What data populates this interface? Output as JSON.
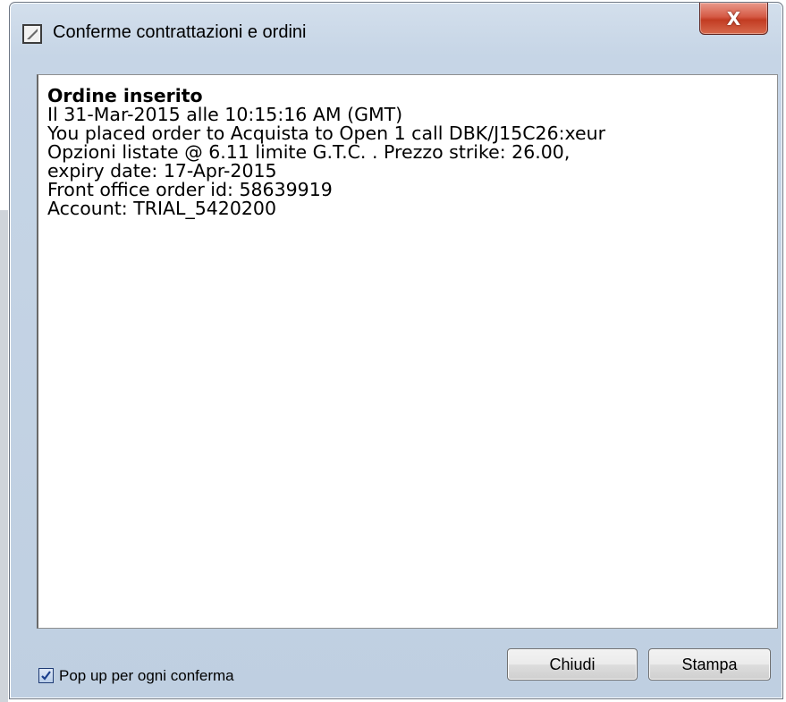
{
  "window": {
    "title": "Conferme contrattazioni e ordini",
    "close_label": "X"
  },
  "message": {
    "title": "Ordine inserito",
    "lines": [
      "Il 31-Mar-2015 alle 10:15:16 AM (GMT)",
      "You placed order to Acquista to Open 1 call DBK/J15C26:xeur",
      "Opzioni listate @ 6.11 limite G.T.C. . Prezzo strike: 26.00,",
      "expiry date: 17-Apr-2015",
      "Front office order id: 58639919",
      "Account: TRIAL_5420200"
    ]
  },
  "footer": {
    "checkbox_label": "Pop up per ogni conferma",
    "checkbox_checked": true,
    "close_button": "Chiudi",
    "print_button": "Stampa"
  }
}
